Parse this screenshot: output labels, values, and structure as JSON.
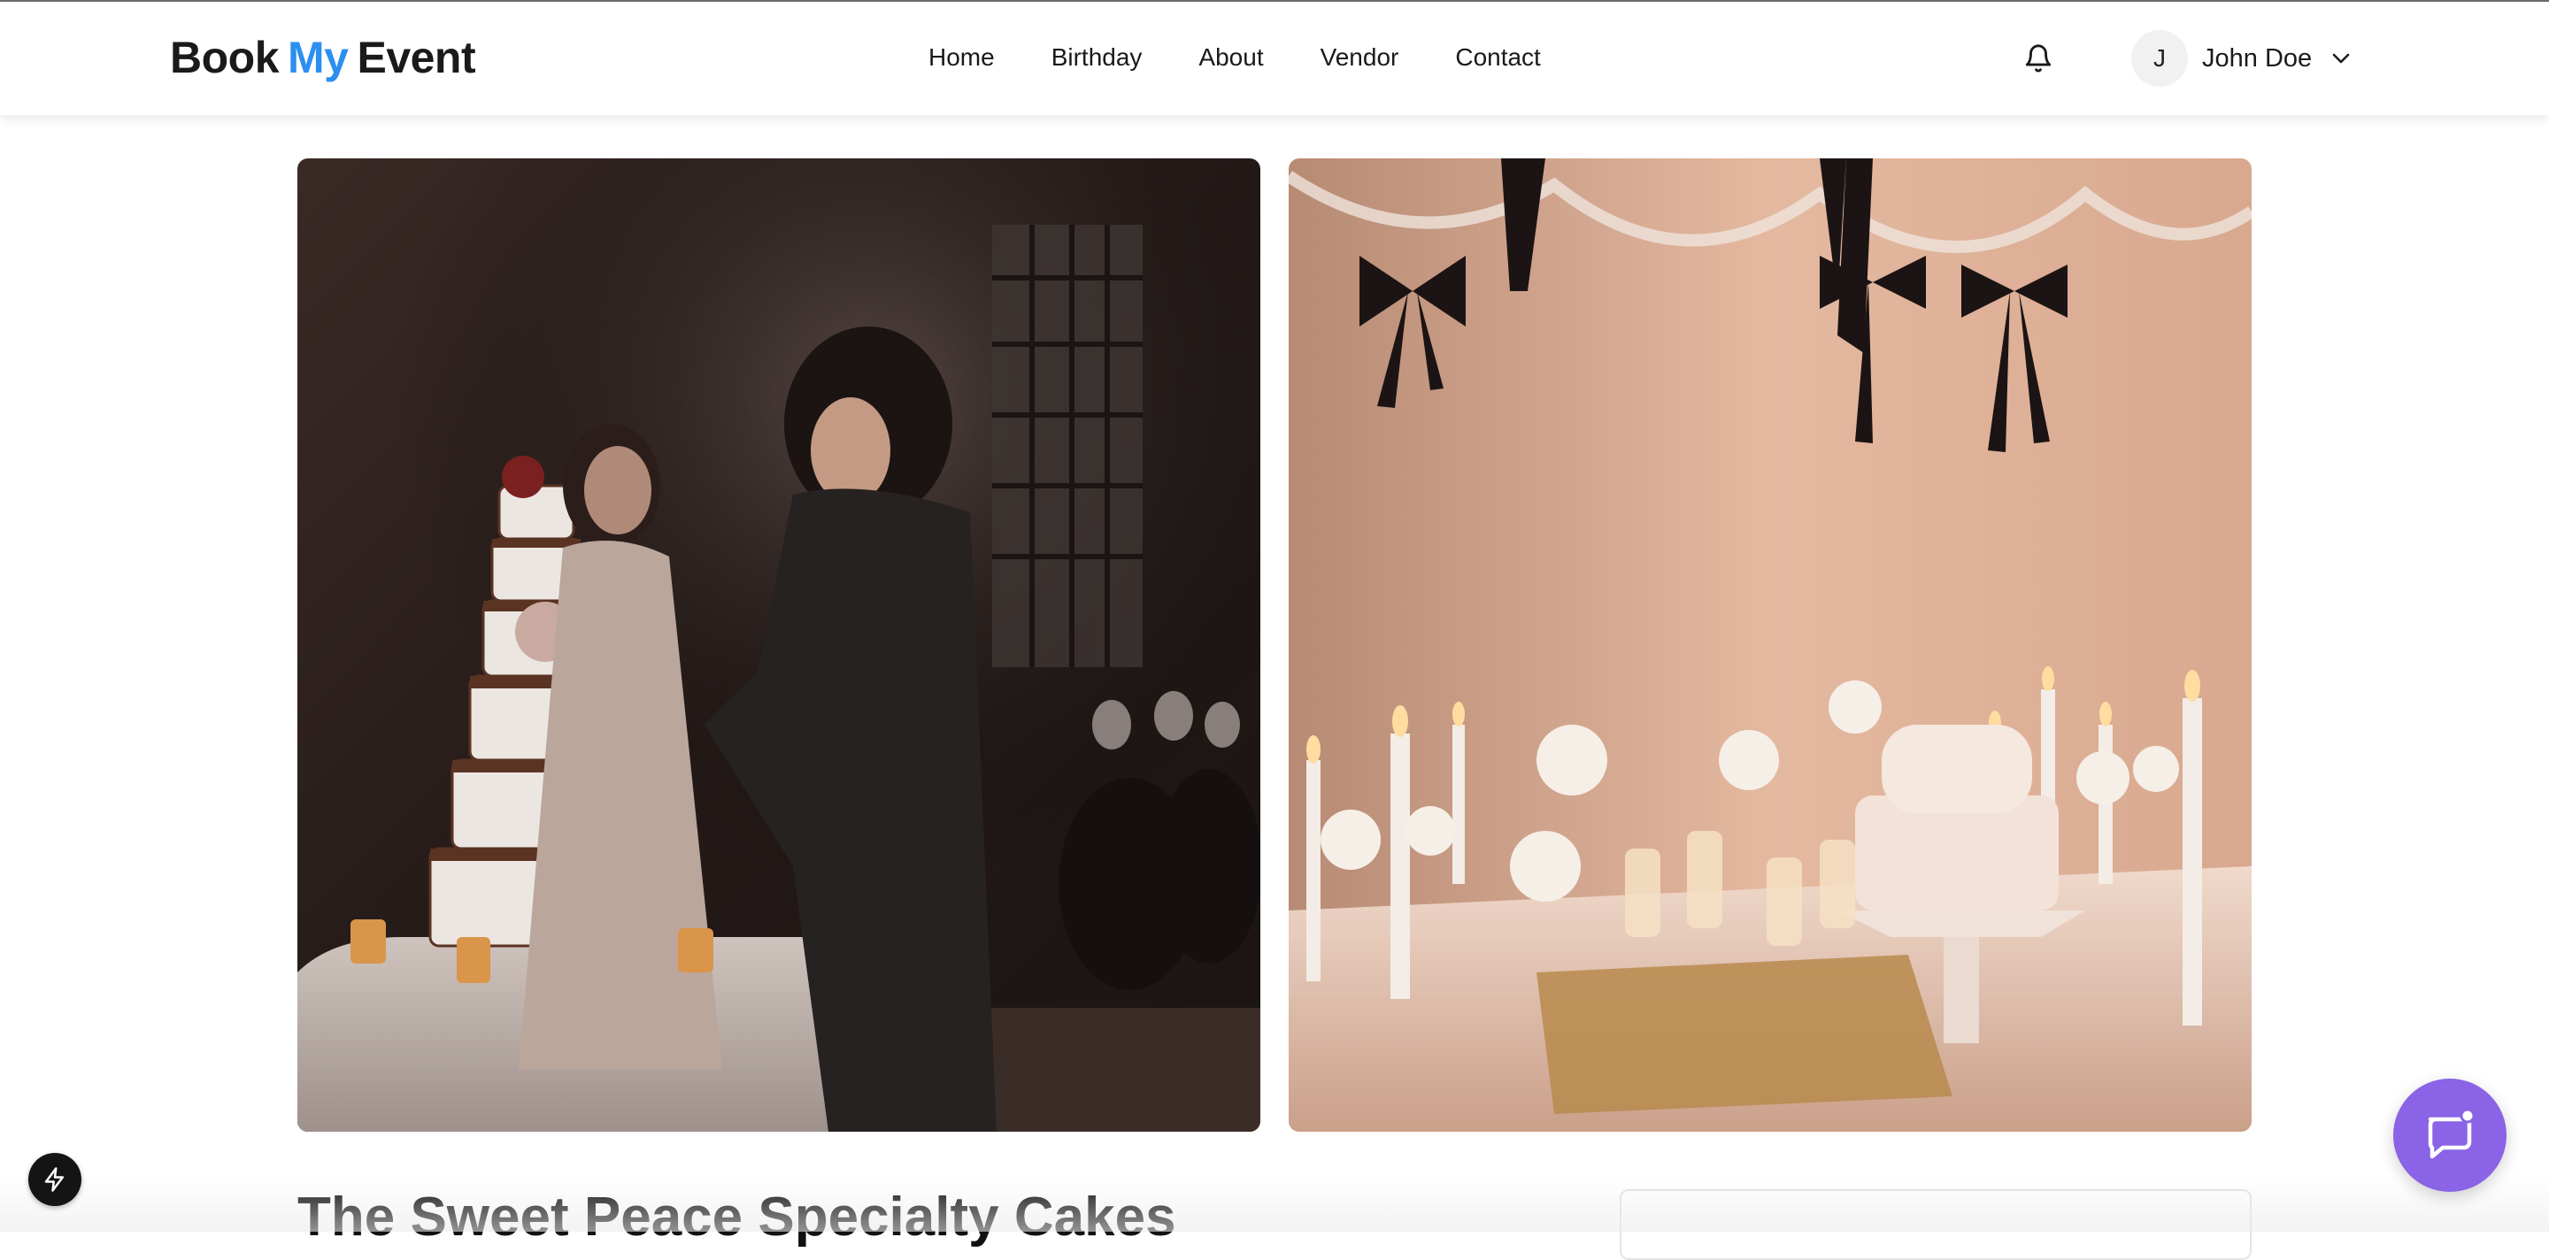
{
  "header": {
    "logo": {
      "part1": "Book",
      "part2": "My",
      "part3": "Event"
    },
    "nav": [
      {
        "label": "Home"
      },
      {
        "label": "Birthday"
      },
      {
        "label": "About"
      },
      {
        "label": "Vendor"
      },
      {
        "label": "Contact"
      }
    ],
    "notification_icon": "bell-icon",
    "user": {
      "initial": "J",
      "name": "John Doe"
    }
  },
  "gallery": {
    "images": [
      {
        "subject": "Bride feeding groom wedding cake beside a tiered drip cake at a candlelit reception"
      },
      {
        "subject": "Candlelit dessert table with white roses, champagne glasses, a bow-topped cake and black ribbon garland"
      }
    ]
  },
  "listing": {
    "title": "The Sweet Peace Specialty Cakes"
  },
  "widgets": {
    "left_button_icon": "bolt-icon",
    "chat_button_icon": "chat-bubble-icon"
  },
  "colors": {
    "accent": "#2b8ff0",
    "chat_button": "#8a63e6"
  }
}
